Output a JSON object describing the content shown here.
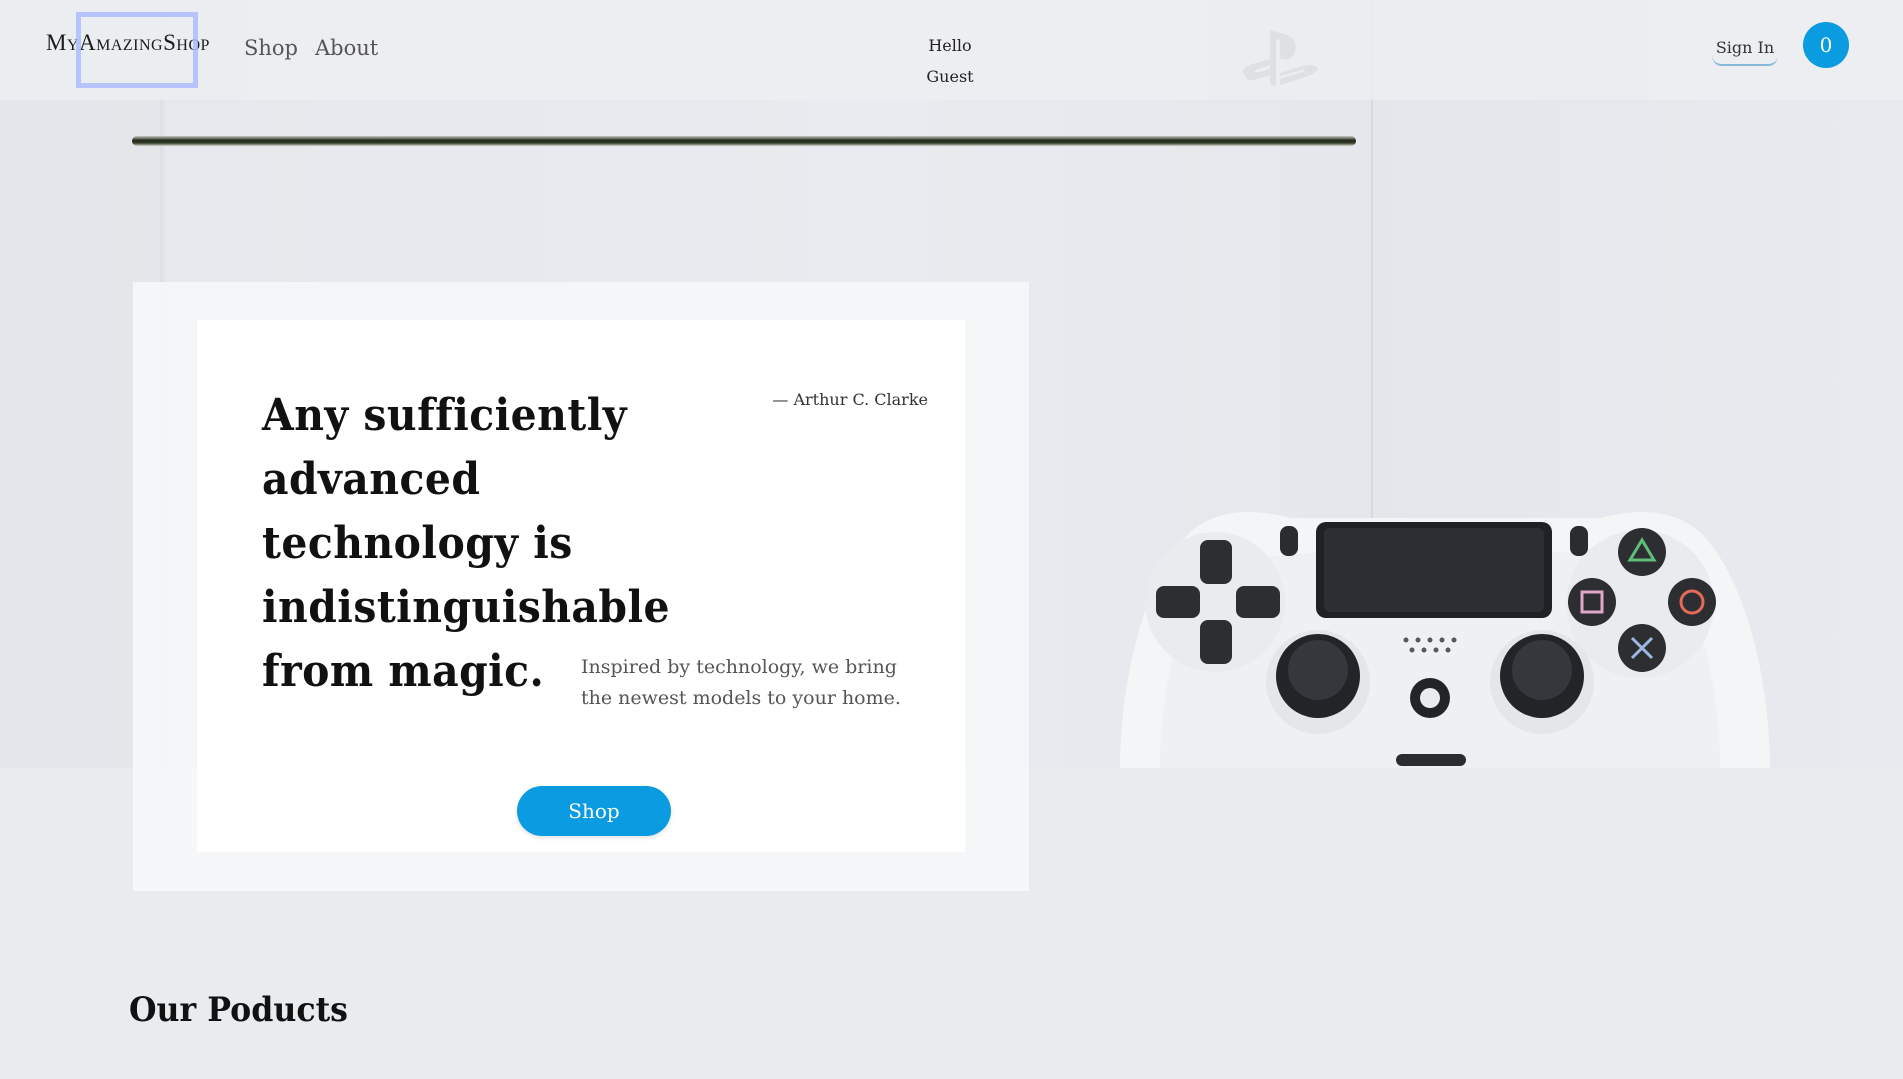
{
  "header": {
    "brand": "MyAmazingShop",
    "nav": [
      "Shop",
      "About"
    ],
    "greeting_line1": "Hello",
    "greeting_line2": "Guest",
    "sign_in": "Sign In",
    "cart_count": "0"
  },
  "hero": {
    "quote": "Any sufficiently advanced technology is indistinguishable from magic.",
    "author": "— Arthur C. Clarke",
    "tagline": "Inspired by technology, we bring the newest models to your home.",
    "cta": "Shop",
    "image": "playstation-controller-photo"
  },
  "products": {
    "title": "Our Poducts"
  },
  "colors": {
    "accent": "#0b9be0",
    "background": "#e9ecee",
    "card": "#ffffff",
    "focus_outline": "#aab9ff"
  },
  "icons": [
    "playstation-logo-icon",
    "controller-image"
  ]
}
